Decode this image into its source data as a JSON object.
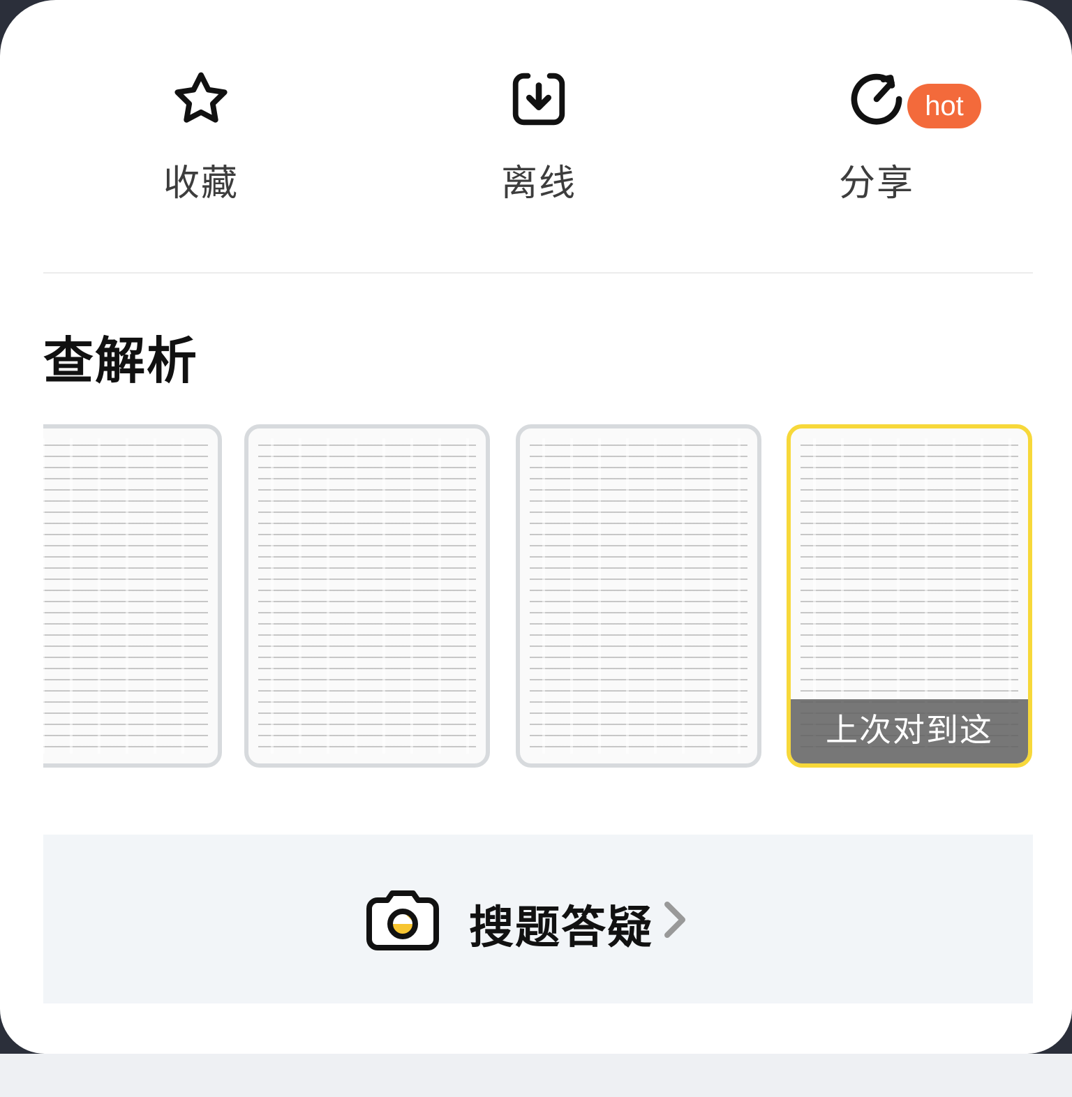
{
  "actions": [
    {
      "label": "收藏",
      "icon": "star-icon"
    },
    {
      "label": "离线",
      "icon": "download-icon"
    },
    {
      "label": "分享",
      "icon": "share-icon",
      "badge": "hot"
    }
  ],
  "section": {
    "title": "查解析"
  },
  "thumbnails": {
    "resume_label": "上次对到这"
  },
  "search": {
    "label": "搜题答疑",
    "icon": "camera-icon"
  },
  "colors": {
    "hot": "#f36a3b",
    "highlight": "#f7d83a",
    "card_bg": "#f2f5f8"
  }
}
